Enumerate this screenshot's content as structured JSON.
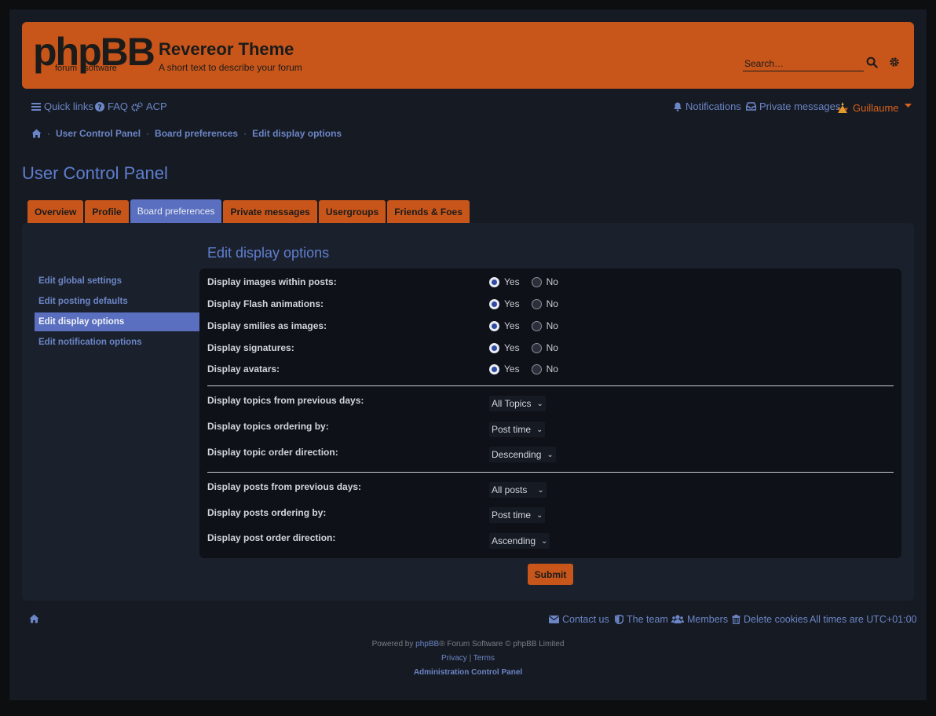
{
  "header": {
    "logo_text": "phpBB",
    "logo_sub": "forum   software",
    "logo_reg": "®",
    "site_title": "Revereor Theme",
    "site_description": "A short text to describe your forum",
    "search_placeholder": "Search…",
    "search_icon": "search-icon",
    "advanced_search_icon": "gear-icon",
    "bg_color": "#c8561a"
  },
  "navbar": {
    "quick_links": "Quick links",
    "faq": "FAQ",
    "acp": "ACP",
    "notifications": "Notifications",
    "private_messages": "Private messages",
    "username": "Guillaume"
  },
  "breadcrumb": [
    "User Control Panel",
    "Board preferences",
    "Edit display options"
  ],
  "page_title": "User Control Panel",
  "tabs": [
    "Overview",
    "Profile",
    "Board preferences",
    "Private messages",
    "Usergroups",
    "Friends & Foes"
  ],
  "active_tab": "Board preferences",
  "sidebar": {
    "items": [
      "Edit global settings",
      "Edit posting defaults",
      "Edit display options",
      "Edit notification options"
    ],
    "active": "Edit display options"
  },
  "content_title": "Edit display options",
  "radio_options": {
    "yes": "Yes",
    "no": "No",
    "rows": [
      {
        "label": "Display images within posts:",
        "value": "Yes"
      },
      {
        "label": "Display Flash animations:",
        "value": "Yes"
      },
      {
        "label": "Display smilies as images:",
        "value": "Yes"
      },
      {
        "label": "Display signatures:",
        "value": "Yes"
      },
      {
        "label": "Display avatars:",
        "value": "Yes"
      }
    ]
  },
  "topic_selects": [
    {
      "label": "Display topics from previous days:",
      "value": "All Topics"
    },
    {
      "label": "Display topics ordering by:",
      "value": "Post time"
    },
    {
      "label": "Display topic order direction:",
      "value": "Descending"
    }
  ],
  "post_selects": [
    {
      "label": "Display posts from previous days:",
      "value": "All posts"
    },
    {
      "label": "Display posts ordering by:",
      "value": "Post time"
    },
    {
      "label": "Display post order direction:",
      "value": "Ascending"
    }
  ],
  "submit_label": "Submit",
  "footer": {
    "contact_us": "Contact us",
    "the_team": "The team",
    "members": "Members",
    "delete_cookies": "Delete cookies",
    "timezone": "All times are UTC+01:00",
    "powered_prefix": "Powered by ",
    "powered_link": "phpBB",
    "powered_suffix": "® Forum Software © phpBB Limited",
    "privacy": "Privacy",
    "pipe": "|",
    "terms": "Terms",
    "acp": "Administration Control Panel"
  },
  "colors": {
    "accent_orange": "#c8561a",
    "link_blue": "#6b85c7",
    "active_blue": "#5a6fbf",
    "page_bg": "#161a22"
  }
}
